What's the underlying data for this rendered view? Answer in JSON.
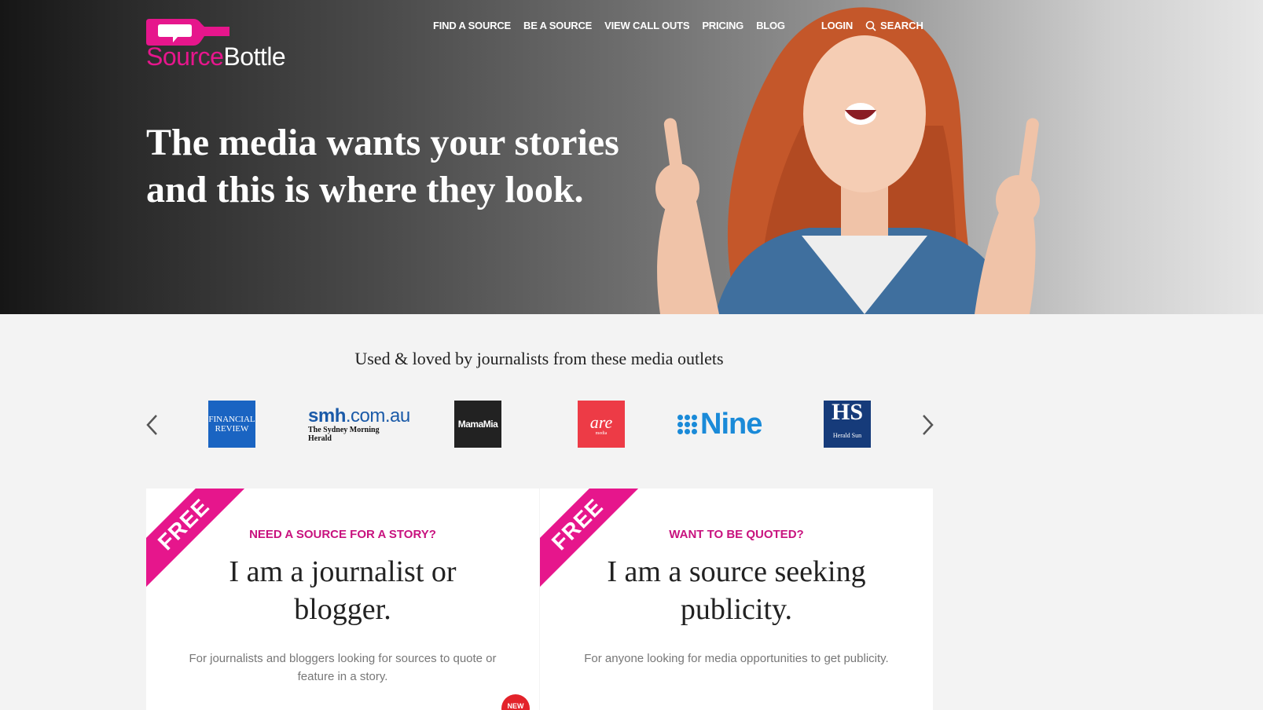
{
  "logo": {
    "part1": "Source",
    "part2": "Bottle"
  },
  "nav": {
    "items": [
      "FIND A SOURCE",
      "BE A SOURCE",
      "VIEW CALL OUTS",
      "PRICING",
      "BLOG"
    ],
    "login": "LOGIN",
    "search": "SEARCH"
  },
  "hero": {
    "line1": "The media wants your stories",
    "line2": "and this is where they look."
  },
  "outlets": {
    "title": "Used & loved by journalists from these media outlets",
    "afr": {
      "l1": "FINANCIAL",
      "l2": "REVIEW"
    },
    "smh": {
      "bold": "smh",
      "rest": ".com.au",
      "sub": "The Sydney Morning Herald"
    },
    "mamamia": "MamaMia",
    "are": {
      "main": "are",
      "sub": "media"
    },
    "nine": "Nine",
    "hs": {
      "main": "HS",
      "sub": "Herald Sun"
    }
  },
  "cards": [
    {
      "ribbon": "FREE",
      "kicker": "NEED A SOURCE FOR A STORY?",
      "title": "I am a journalist or blogger.",
      "desc": "For journalists and bloggers looking for sources to quote or feature in a story.",
      "badge": "NEW"
    },
    {
      "ribbon": "FREE",
      "kicker": "WANT TO BE QUOTED?",
      "title": "I am a source seeking publicity.",
      "desc": "For anyone looking for media opportunities to get publicity."
    }
  ],
  "colors": {
    "brand": "#e6168c",
    "kicker": "#c8127e"
  }
}
